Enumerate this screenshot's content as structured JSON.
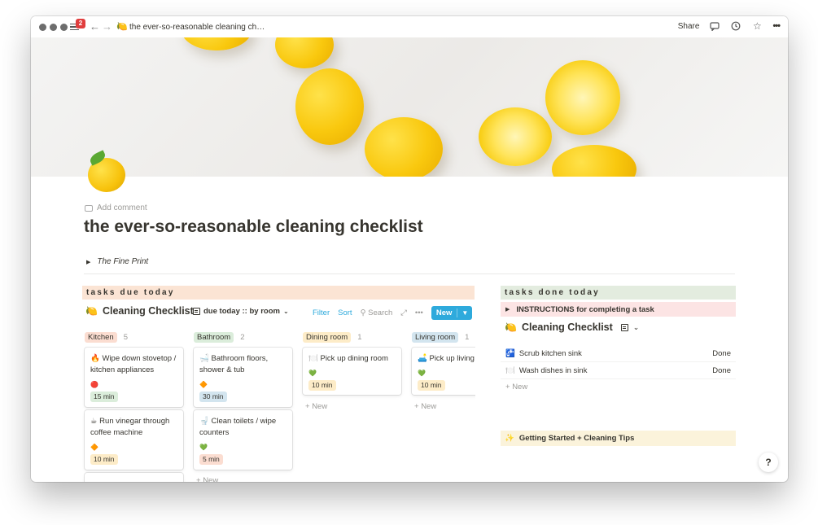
{
  "window": {
    "notification_count": "2",
    "breadcrumb": "the ever-so-reasonable cleaning ch…",
    "share_label": "Share",
    "more": "•••"
  },
  "page": {
    "add_comment": "Add comment",
    "title": "the ever-so-reasonable cleaning checklist",
    "toggle": "The Fine Print"
  },
  "due": {
    "section_title": "tasks due today",
    "db_title": "Cleaning Checklist",
    "view_name": "due today :: by room",
    "filter": "Filter",
    "sort": "Sort",
    "search": "Search",
    "new_label": "New",
    "add_new": "New",
    "columns": [
      {
        "name": "Kitchen",
        "count": "5",
        "tag_color": "#fbddd1",
        "cards": [
          {
            "emoji": "🔥",
            "name": "Wipe down stovetop / kitchen appliances",
            "prio": "🔴",
            "time": "15 min",
            "time_bg": "#dbeddb"
          },
          {
            "emoji": "☕",
            "name": "Run vinegar through coffee machine",
            "prio": "🔶",
            "time": "10 min",
            "time_bg": "#fdecc8"
          }
        ]
      },
      {
        "name": "Bathroom",
        "count": "2",
        "tag_color": "#dbeddb",
        "cards": [
          {
            "emoji": "🛁",
            "name": "Bathroom floors, shower & tub",
            "prio": "🔶",
            "time": "30 min",
            "time_bg": "#d3e5ef"
          },
          {
            "emoji": "🚽",
            "name": "Clean toilets / wipe counters",
            "prio": "💚",
            "time": "5 min",
            "time_bg": "#fbddd1"
          }
        ]
      },
      {
        "name": "Dining room",
        "count": "1",
        "tag_color": "#fdecc8",
        "cards": [
          {
            "emoji": "🍽️",
            "name": "Pick up dining room",
            "prio": "💚",
            "time": "10 min",
            "time_bg": "#fdecc8"
          }
        ]
      },
      {
        "name": "Living room",
        "count": "1",
        "tag_color": "#d3e5ef",
        "cards": [
          {
            "emoji": "🛋️",
            "name": "Pick up living",
            "prio": "💚",
            "time": "10 min",
            "time_bg": "#fdecc8"
          }
        ]
      }
    ]
  },
  "done": {
    "section_title": "tasks done today",
    "instructions": "INSTRUCTIONS for completing a task",
    "db_title": "Cleaning Checklist",
    "rows": [
      {
        "emoji": "🚰",
        "name": "Scrub kitchen sink",
        "status": "Done"
      },
      {
        "emoji": "🍽️",
        "name": "Wash dishes in sink",
        "status": "Done"
      }
    ],
    "add_new": "New"
  },
  "tips": "Getting Started + Cleaning Tips",
  "help": "?"
}
